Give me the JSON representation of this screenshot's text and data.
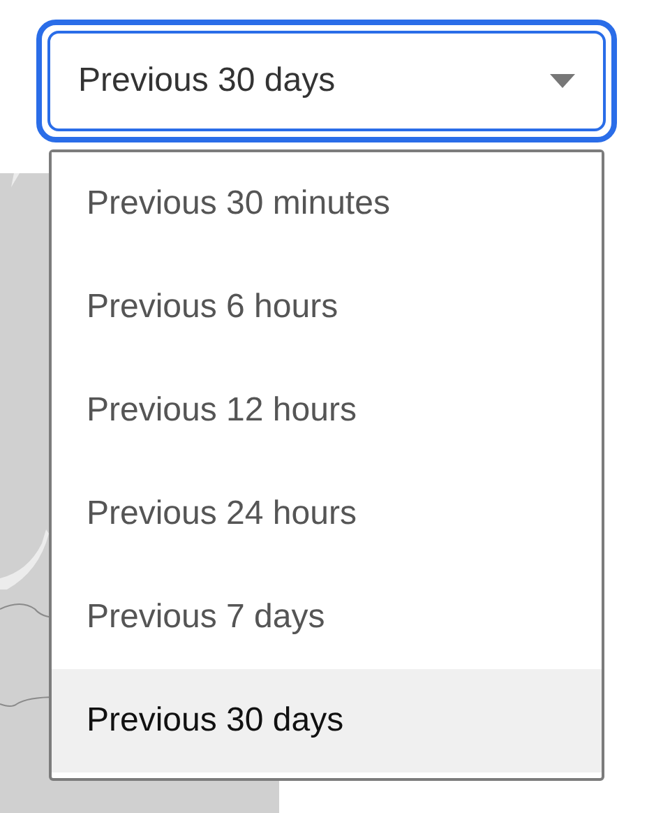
{
  "select": {
    "value": "Previous 30 days",
    "expanded": true
  },
  "options": [
    {
      "label": "Previous 30 minutes",
      "selected": false
    },
    {
      "label": "Previous 6 hours",
      "selected": false
    },
    {
      "label": "Previous 12 hours",
      "selected": false
    },
    {
      "label": "Previous 24 hours",
      "selected": false
    },
    {
      "label": "Previous 7 days",
      "selected": false
    },
    {
      "label": "Previous 30 days",
      "selected": true
    }
  ]
}
